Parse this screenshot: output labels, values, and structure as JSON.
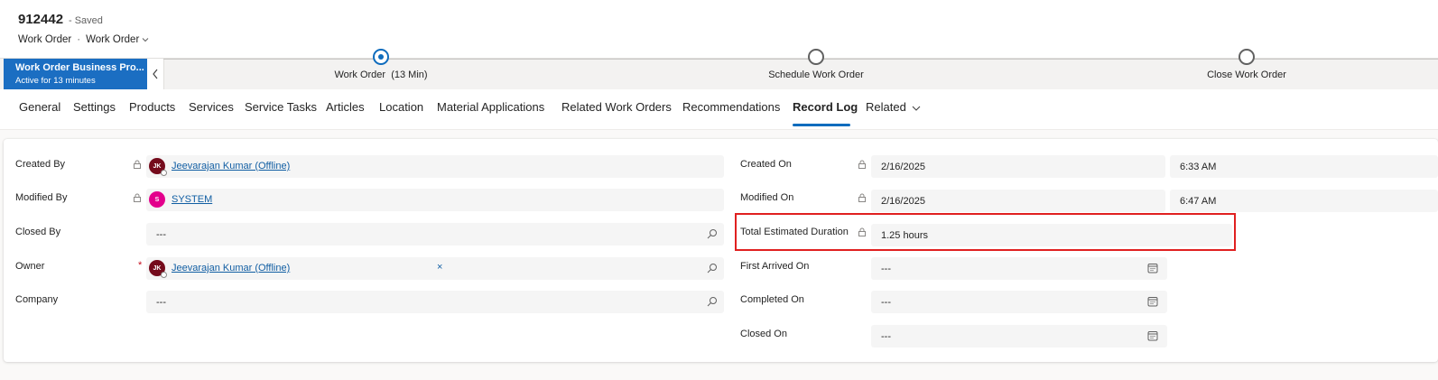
{
  "header": {
    "title": "912442",
    "status": "- Saved",
    "entity": "Work Order",
    "form": "Work Order"
  },
  "bpf": {
    "name": "Work Order Business Pro...",
    "status": "Active for 13 minutes",
    "stages": [
      {
        "name": "Work Order",
        "duration": "(13 Min)",
        "state": "active"
      },
      {
        "name": "Schedule Work Order",
        "state": "pending"
      },
      {
        "name": "Close Work Order",
        "state": "pending"
      }
    ]
  },
  "tabs": [
    "General",
    "Settings",
    "Products",
    "Services",
    "Service Tasks",
    "Articles",
    "Location",
    "Material Applications",
    "Related Work Orders",
    "Recommendations",
    "Record Log",
    "Related"
  ],
  "active_tab": "Record Log",
  "left_fields": {
    "created_by": {
      "label": "Created By",
      "value": "Jeevarajan Kumar (Offline)",
      "initials": "JK"
    },
    "modified_by": {
      "label": "Modified By",
      "value": "SYSTEM",
      "initials": "S"
    },
    "closed_by": {
      "label": "Closed By",
      "value": "---"
    },
    "owner": {
      "label": "Owner",
      "value": "Jeevarajan Kumar (Offline)",
      "initials": "JK",
      "required": "*",
      "remove": "×"
    },
    "company": {
      "label": "Company",
      "value": "---"
    }
  },
  "right_fields": {
    "created_on": {
      "label": "Created On",
      "date": "2/16/2025",
      "time": "6:33 AM"
    },
    "modified_on": {
      "label": "Modified On",
      "date": "2/16/2025",
      "time": "6:47 AM"
    },
    "total_estimated_duration": {
      "label": "Total Estimated Duration",
      "value": "1.25 hours"
    },
    "first_arrived_on": {
      "label": "First Arrived On",
      "value": "---"
    },
    "completed_on": {
      "label": "Completed On",
      "value": "---"
    },
    "closed_on": {
      "label": "Closed On",
      "value": "---"
    }
  },
  "colors": {
    "accent": "#0f6cbd",
    "bpf_flag": "#1b6ec2",
    "avatar_jk": "#750b1c",
    "avatar_s": "#e3008c",
    "highlight": "#e02020"
  }
}
